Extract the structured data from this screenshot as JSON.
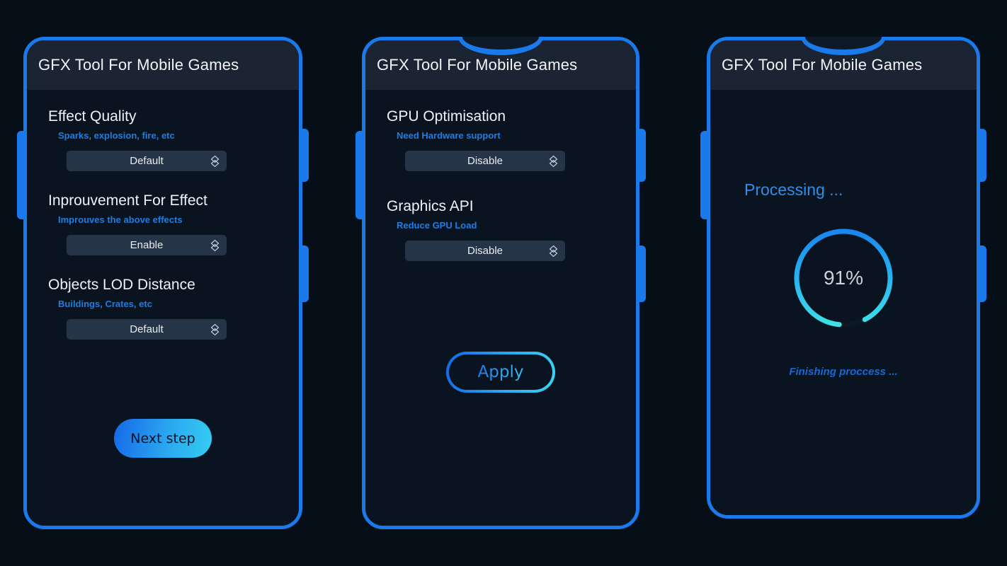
{
  "app": {
    "title": "GFX Tool For Mobile Games",
    "accent_blue": "#1a7aec",
    "accent_cyan": "#35cdf2",
    "subtitle_blue": "#1e7de0",
    "header_bg": "#1b2433",
    "body_bg": "#0a1421",
    "page_bg": "#060f18",
    "select_bg": "#263448"
  },
  "screens": [
    {
      "id": "screen-settings-1",
      "title": "GFX Tool For Mobile Games",
      "has_notch": false,
      "settings": [
        {
          "title": "Effect Quality",
          "subtitle": "Sparks, explosion, fire, etc",
          "select_value": "Default",
          "select_icon": "chevron-up-down-icon"
        },
        {
          "title": "Inprouvement For Effect",
          "subtitle": "Improuves the above effects",
          "select_value": "Enable",
          "select_icon": "chevron-up-down-icon"
        },
        {
          "title": "Objects LOD Distance",
          "subtitle": "Buildings, Crates, etc",
          "select_value": "Default",
          "select_icon": "chevron-up-down-icon"
        }
      ],
      "primary_button": "Next step"
    },
    {
      "id": "screen-settings-2",
      "title": "GFX Tool For Mobile Games",
      "has_notch": true,
      "settings": [
        {
          "title": "GPU Optimisation",
          "subtitle": "Need Hardware support",
          "select_value": "Disable",
          "select_icon": "chevron-up-down-icon"
        },
        {
          "title": "Graphics API",
          "subtitle": "Reduce GPU Load",
          "select_value": "Disable",
          "select_icon": "chevron-up-down-icon"
        }
      ],
      "primary_button": "Apply"
    },
    {
      "id": "screen-progress",
      "title": "GFX Tool For Mobile Games",
      "has_notch": true,
      "status_heading": "Processing ...",
      "progress_percent_label": "91%",
      "progress_percent_value": 91,
      "footer_status": "Finishing proccess ..."
    }
  ]
}
